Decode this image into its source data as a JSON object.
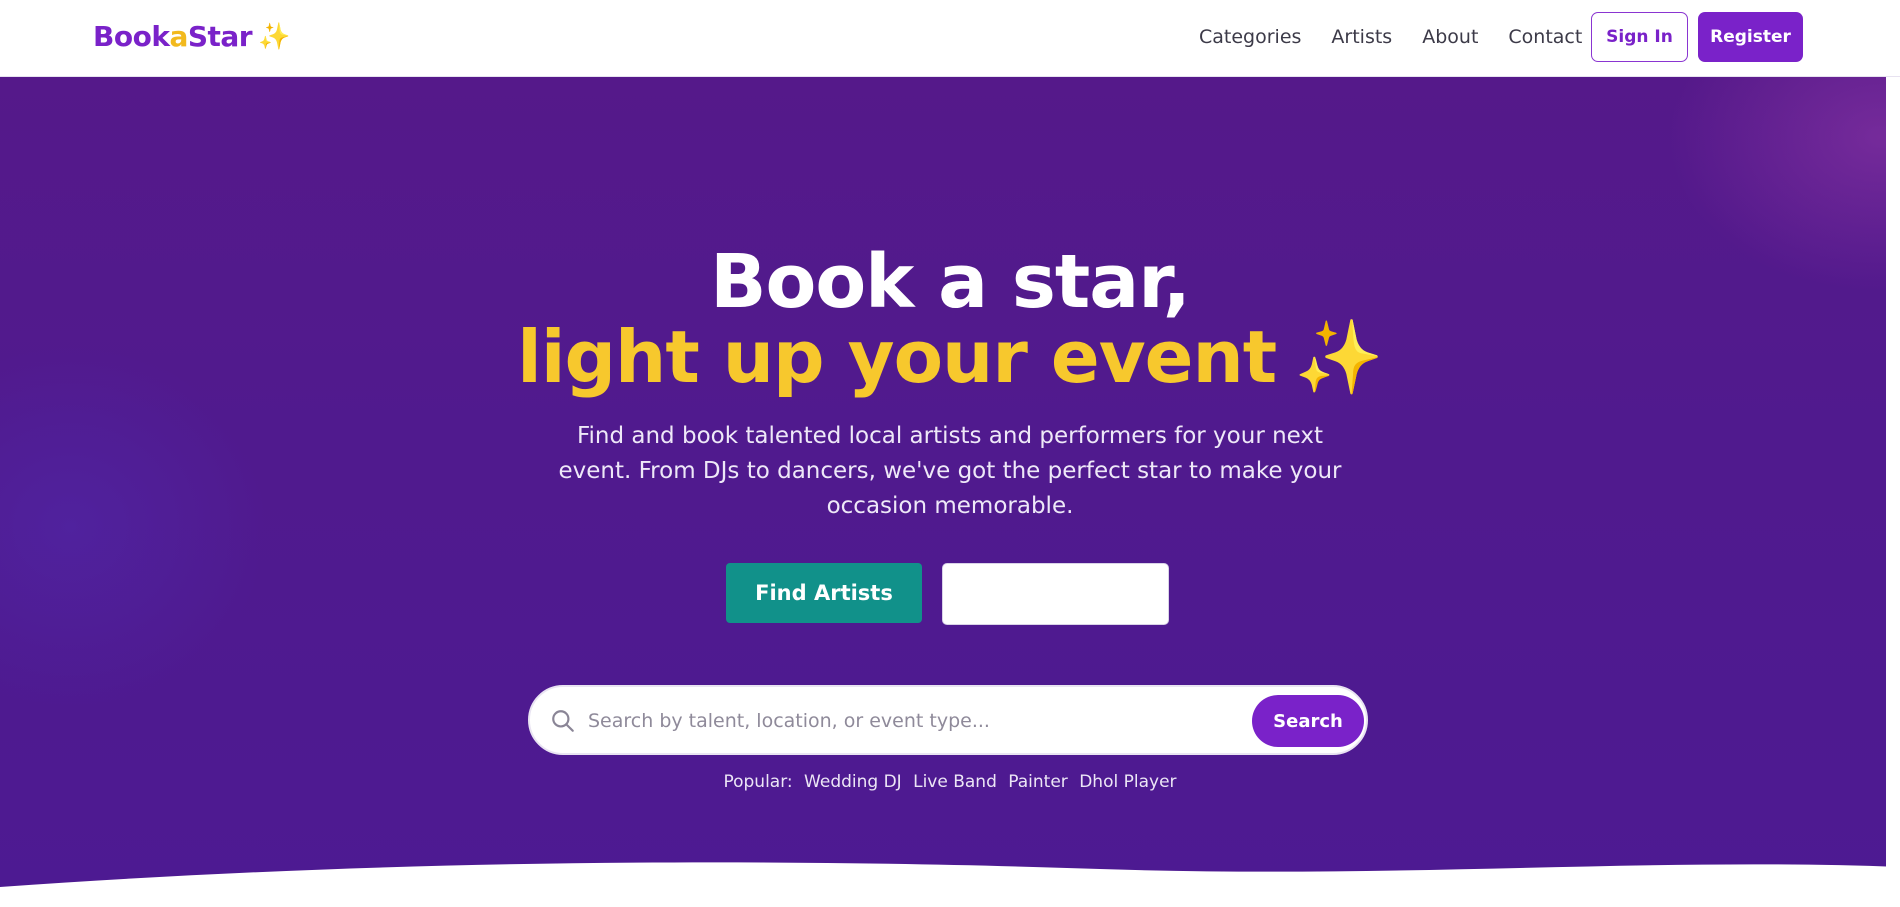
{
  "header": {
    "brand": {
      "part1": "Book",
      "part2": "a",
      "part3": "Star",
      "spark": "✨"
    },
    "nav": [
      "Categories",
      "Artists",
      "About",
      "Contact"
    ],
    "sign_in": "Sign In",
    "register": "Register"
  },
  "hero": {
    "headline_line1": "Book a star,",
    "headline_line2": "light up your event",
    "headline_spark": "✨",
    "subtitle": "Find and book talented local artists and performers for your next event. From DJs to dancers, we've got the perfect star to make your occasion memorable.",
    "primary_cta": "Find Artists",
    "secondary_cta": ""
  },
  "search": {
    "placeholder": "Search by talent, location, or event type...",
    "value": "",
    "button": "Search"
  },
  "popular": {
    "label": "Popular:",
    "tags": [
      "Wedding DJ",
      "Live Band",
      "Painter",
      "Dhol Player"
    ]
  },
  "colors": {
    "brand": "#7a22c9",
    "accent_yellow": "#f7c82d",
    "teal": "#11918a",
    "hero_bg": "#501a8e"
  },
  "icons": {
    "search": "search-icon",
    "sparkle": "sparkles-icon"
  }
}
